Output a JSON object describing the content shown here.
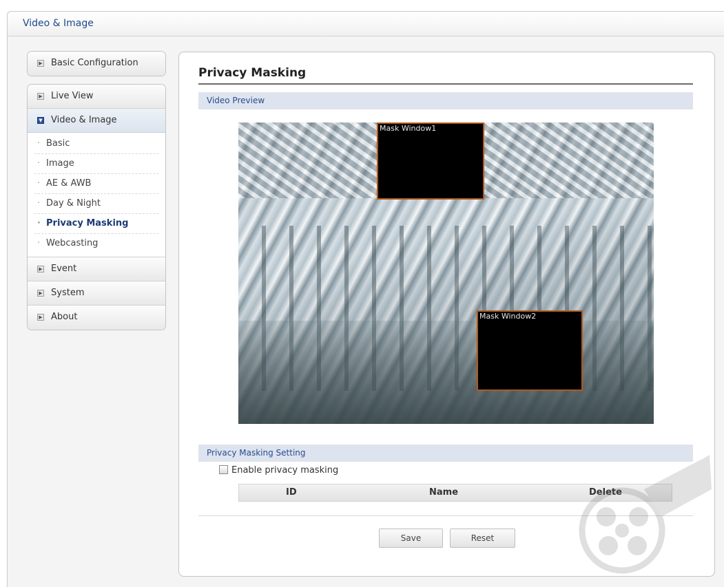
{
  "window": {
    "title": "Video & Image"
  },
  "sidebar": {
    "basic_configuration": "Basic Configuration",
    "sections": [
      {
        "label": "Live View",
        "expanded": false
      },
      {
        "label": "Video & Image",
        "expanded": true,
        "items": [
          "Basic",
          "Image",
          "AE & AWB",
          "Day & Night",
          "Privacy Masking",
          "Webcasting"
        ],
        "current": "Privacy Masking"
      },
      {
        "label": "Event",
        "expanded": false
      },
      {
        "label": "System",
        "expanded": false
      },
      {
        "label": "About",
        "expanded": false
      }
    ]
  },
  "main": {
    "title": "Privacy Masking",
    "video_preview": {
      "heading": "Video Preview",
      "masks": [
        {
          "label": "Mask Window1"
        },
        {
          "label": "Mask Window2"
        }
      ]
    },
    "setting": {
      "heading": "Privacy Masking Setting",
      "enable_label": "Enable privacy masking",
      "enabled": false,
      "table": {
        "columns": [
          "ID",
          "Name",
          "Delete"
        ],
        "rows": []
      }
    },
    "buttons": {
      "save": "Save",
      "reset": "Reset"
    }
  },
  "colors": {
    "accent": "#2a4c8c",
    "mask_border": "#b25a1b",
    "section_bg": "#dde3ef"
  },
  "icons": {
    "collapsed": "expand-box-icon",
    "expanded": "collapse-box-icon",
    "decoration": "film-reel-icon"
  }
}
